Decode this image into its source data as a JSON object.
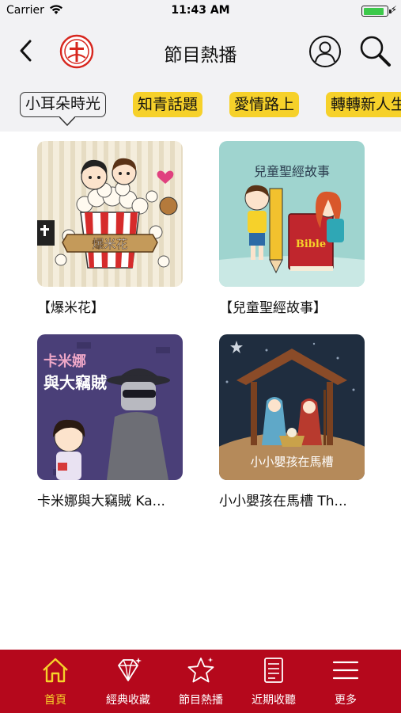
{
  "status_bar": {
    "carrier": "Carrier",
    "time": "11:43 AM",
    "battery_level": 0.9
  },
  "nav": {
    "title": "節目熱播",
    "back_icon": "chevron-left-icon",
    "logo_icon": "cross-logo-icon",
    "profile_icon": "user-icon",
    "search_icon": "search-icon"
  },
  "tabs": [
    {
      "label": "小耳朵時光",
      "active": true
    },
    {
      "label": "知青話題",
      "active": false
    },
    {
      "label": "愛情路上",
      "active": false
    },
    {
      "label": "轉轉新人生",
      "active": false
    }
  ],
  "programs": [
    {
      "title": "【爆米花】",
      "art_text": "爆米花"
    },
    {
      "title": "【兒童聖經故事】",
      "art_text": "兒童聖經故事",
      "book_text": "Bible"
    },
    {
      "title": "卡米娜與大竊賊 Ka...",
      "art_text_1": "卡米娜",
      "art_text_2": "與大竊賊"
    },
    {
      "title": "小小嬰孩在馬槽 Th...",
      "art_text": "小小嬰孩在馬槽"
    }
  ],
  "tab_bar": [
    {
      "label": "首頁",
      "icon": "home-icon",
      "active": true
    },
    {
      "label": "經典收藏",
      "icon": "diamond-icon",
      "active": false
    },
    {
      "label": "節目熱播",
      "icon": "star-icon",
      "active": false
    },
    {
      "label": "近期收聽",
      "icon": "document-icon",
      "active": false
    },
    {
      "label": "更多",
      "icon": "menu-icon",
      "active": false
    }
  ],
  "colors": {
    "accent_yellow": "#f6d12a",
    "tab_bar_red": "#b5081c",
    "nav_background": "#f2f2f4"
  }
}
